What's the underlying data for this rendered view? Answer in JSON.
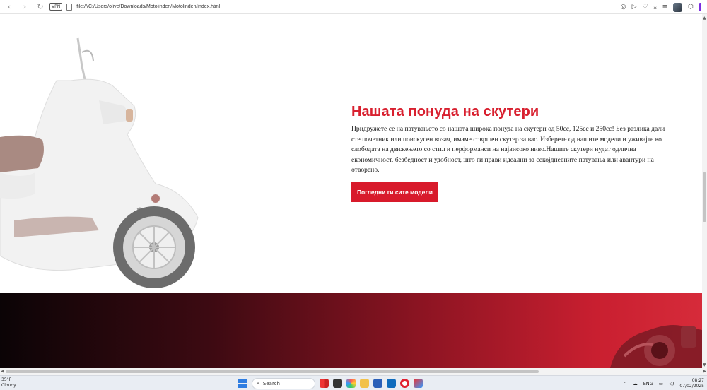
{
  "browser": {
    "url": "file:///C:/Users/olive/Downloads/Motolinden/Motolinden/index.html",
    "vpn_label": "VPN"
  },
  "section": {
    "heading": "Нашата понуда на скутери",
    "paragraph": "Придружете се на патувањето со нашата широка понуда на скутери од 50cc, 125cc и 250cc! Без разлика дали сте почетник или поискусен возач, имаме совршен скутер за вас. Изберете од нашите модели и уживајте во слободата на движењето со стил и перформанси на највисоко ниво.Нашите скутери нудат одлична економичност, безбедност и удобност, што ги прави идеални за секојдневните патувања или авантури на отворено.",
    "cta_label": "Погледни ги сите модели"
  },
  "taskbar": {
    "weather_temp": "35°F",
    "weather_desc": "Cloudy",
    "search_label": "Search",
    "language": "ENG",
    "time": "08:27",
    "date": "07/02/2025"
  },
  "colors": {
    "accent": "#d8202f",
    "button": "#d81a2b",
    "band_start": "#0b0406",
    "band_end": "#d62b3a"
  }
}
